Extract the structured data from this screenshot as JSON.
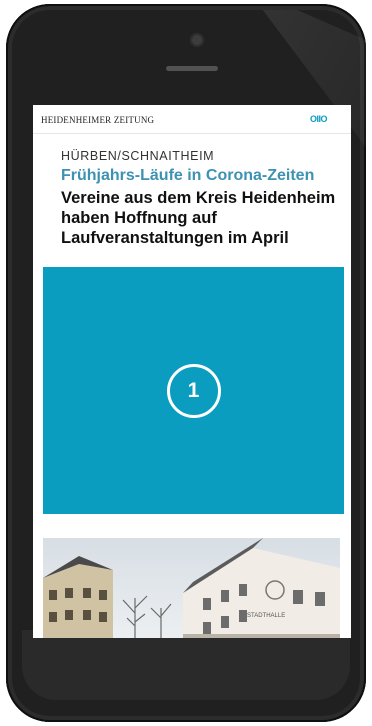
{
  "newspaper": {
    "logo_text": "HEIDENHEIMER ZEITUNG",
    "badge_text": "OIIO"
  },
  "article": {
    "kicker": "HÜRBEN/SCHNAITHEIM",
    "subheadline": "Frühjahrs-Läufe in Corona-Zeiten",
    "headline": "Vereine aus dem Kreis Heidenheim haben Hoffnung auf Laufveranstaltungen im April"
  },
  "teaser": {
    "number": "1",
    "color": "#0a9dc0"
  },
  "colors": {
    "accent": "#0a9dc0",
    "subheadline": "#3d92b2",
    "phone_body": "#202020"
  },
  "photo": {
    "sign_text": "STADTHALLE"
  }
}
